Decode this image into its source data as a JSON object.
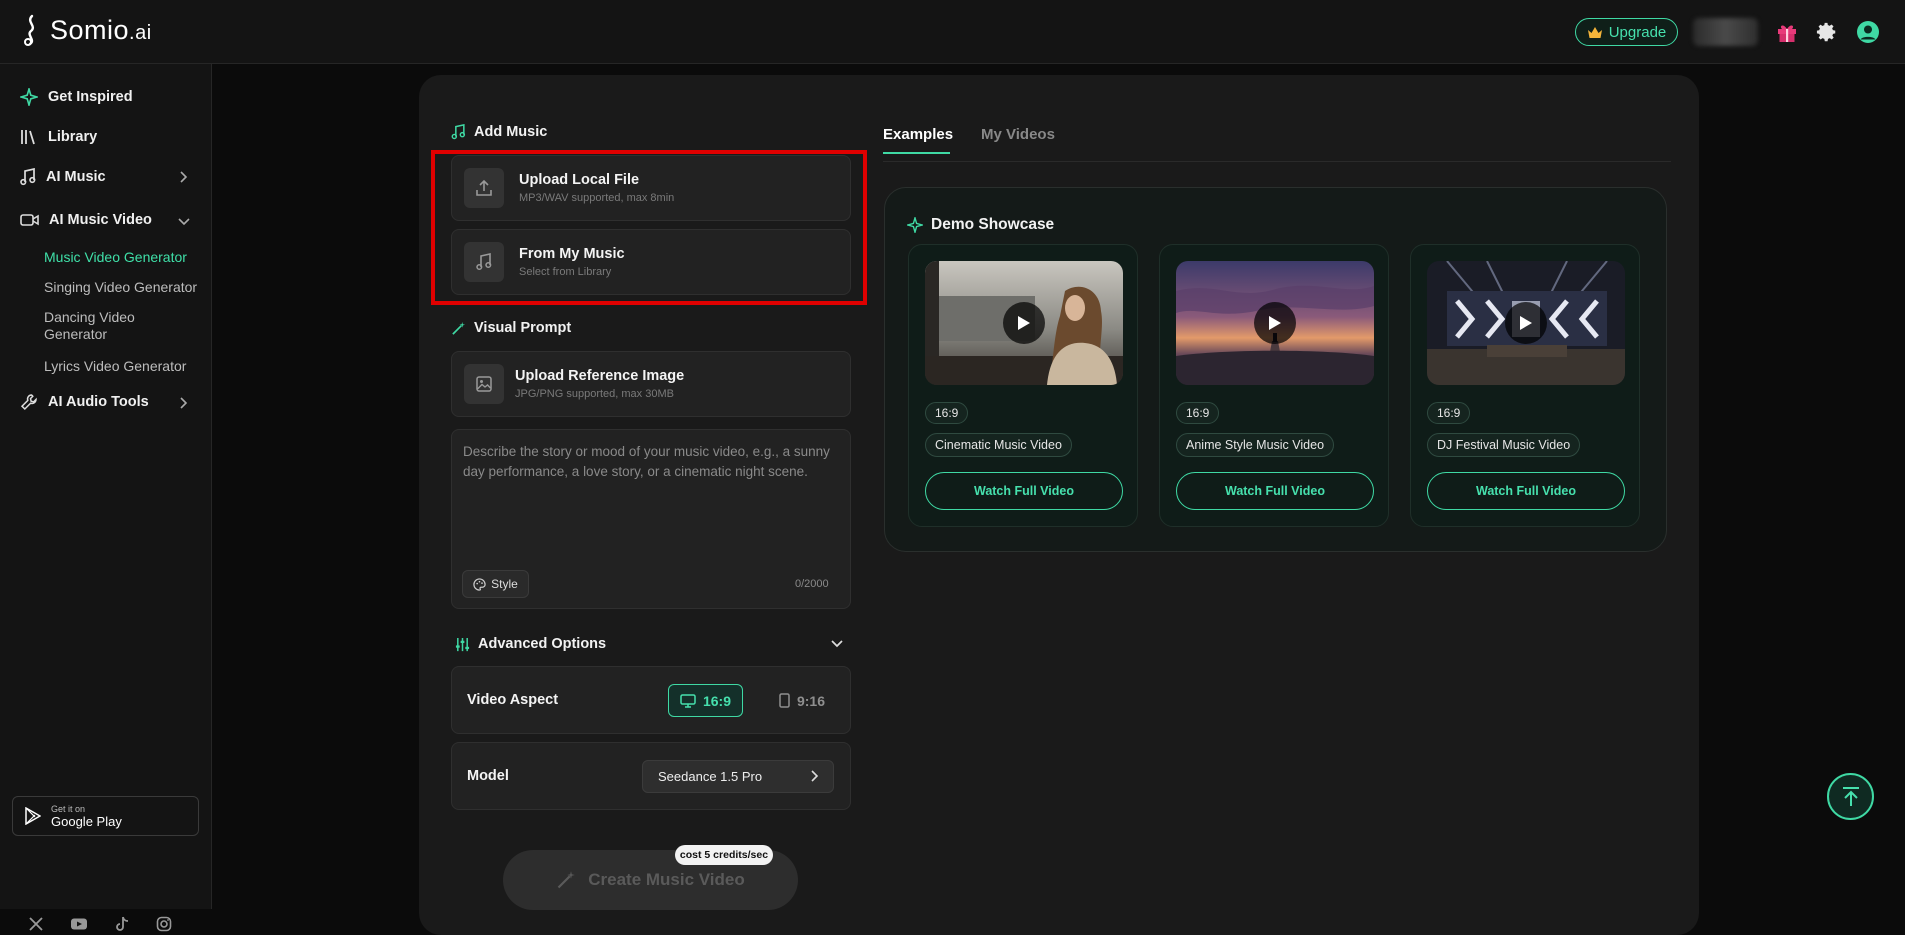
{
  "brand": {
    "name": "Somio",
    "suffix": ".ai"
  },
  "header": {
    "upgrade_label": "Upgrade"
  },
  "sidebar": {
    "items": [
      {
        "label": "Get Inspired"
      },
      {
        "label": "Library"
      },
      {
        "label": "AI Music"
      },
      {
        "label": "AI Music Video"
      },
      {
        "label": "AI Audio Tools"
      }
    ],
    "subitems": [
      {
        "label": "Music Video Generator",
        "active": true
      },
      {
        "label": "Singing Video Generator"
      },
      {
        "label": "Dancing Video Generator"
      },
      {
        "label": "Lyrics Video Generator"
      }
    ],
    "google_play": {
      "small": "Get it on",
      "big": "Google Play"
    }
  },
  "add_music": {
    "title": "Add Music",
    "upload": {
      "title": "Upload Local File",
      "sub": "MP3/WAV supported, max 8min"
    },
    "from_library": {
      "title": "From My Music",
      "sub": "Select from Library"
    }
  },
  "visual_prompt": {
    "title": "Visual Prompt",
    "upload": {
      "title": "Upload Reference Image",
      "sub": "JPG/PNG supported, max 30MB"
    },
    "placeholder": "Describe the story or mood of your music video, e.g., a sunny day performance, a love story, or a cinematic night scene.",
    "style_label": "Style",
    "counter": "0/2000"
  },
  "advanced": {
    "title": "Advanced Options",
    "aspect_label": "Video Aspect",
    "aspect_options": [
      "16:9",
      "9:16"
    ],
    "model_label": "Model",
    "model_value": "Seedance 1.5 Pro"
  },
  "create": {
    "label": "Create Music Video",
    "cost": "cost 5 credits/sec"
  },
  "tabs": [
    "Examples",
    "My Videos"
  ],
  "showcase": {
    "title": "Demo Showcase",
    "cards": [
      {
        "ratio": "16:9",
        "name": "Cinematic Music Video",
        "button": "Watch Full Video"
      },
      {
        "ratio": "16:9",
        "name": "Anime Style Music Video",
        "button": "Watch Full Video"
      },
      {
        "ratio": "16:9",
        "name": "DJ Festival Music Video",
        "button": "Watch Full Video"
      }
    ]
  },
  "colors": {
    "accent": "#3fd9a4",
    "highlight_box": "#e00000",
    "background": "#0b0b0b"
  }
}
